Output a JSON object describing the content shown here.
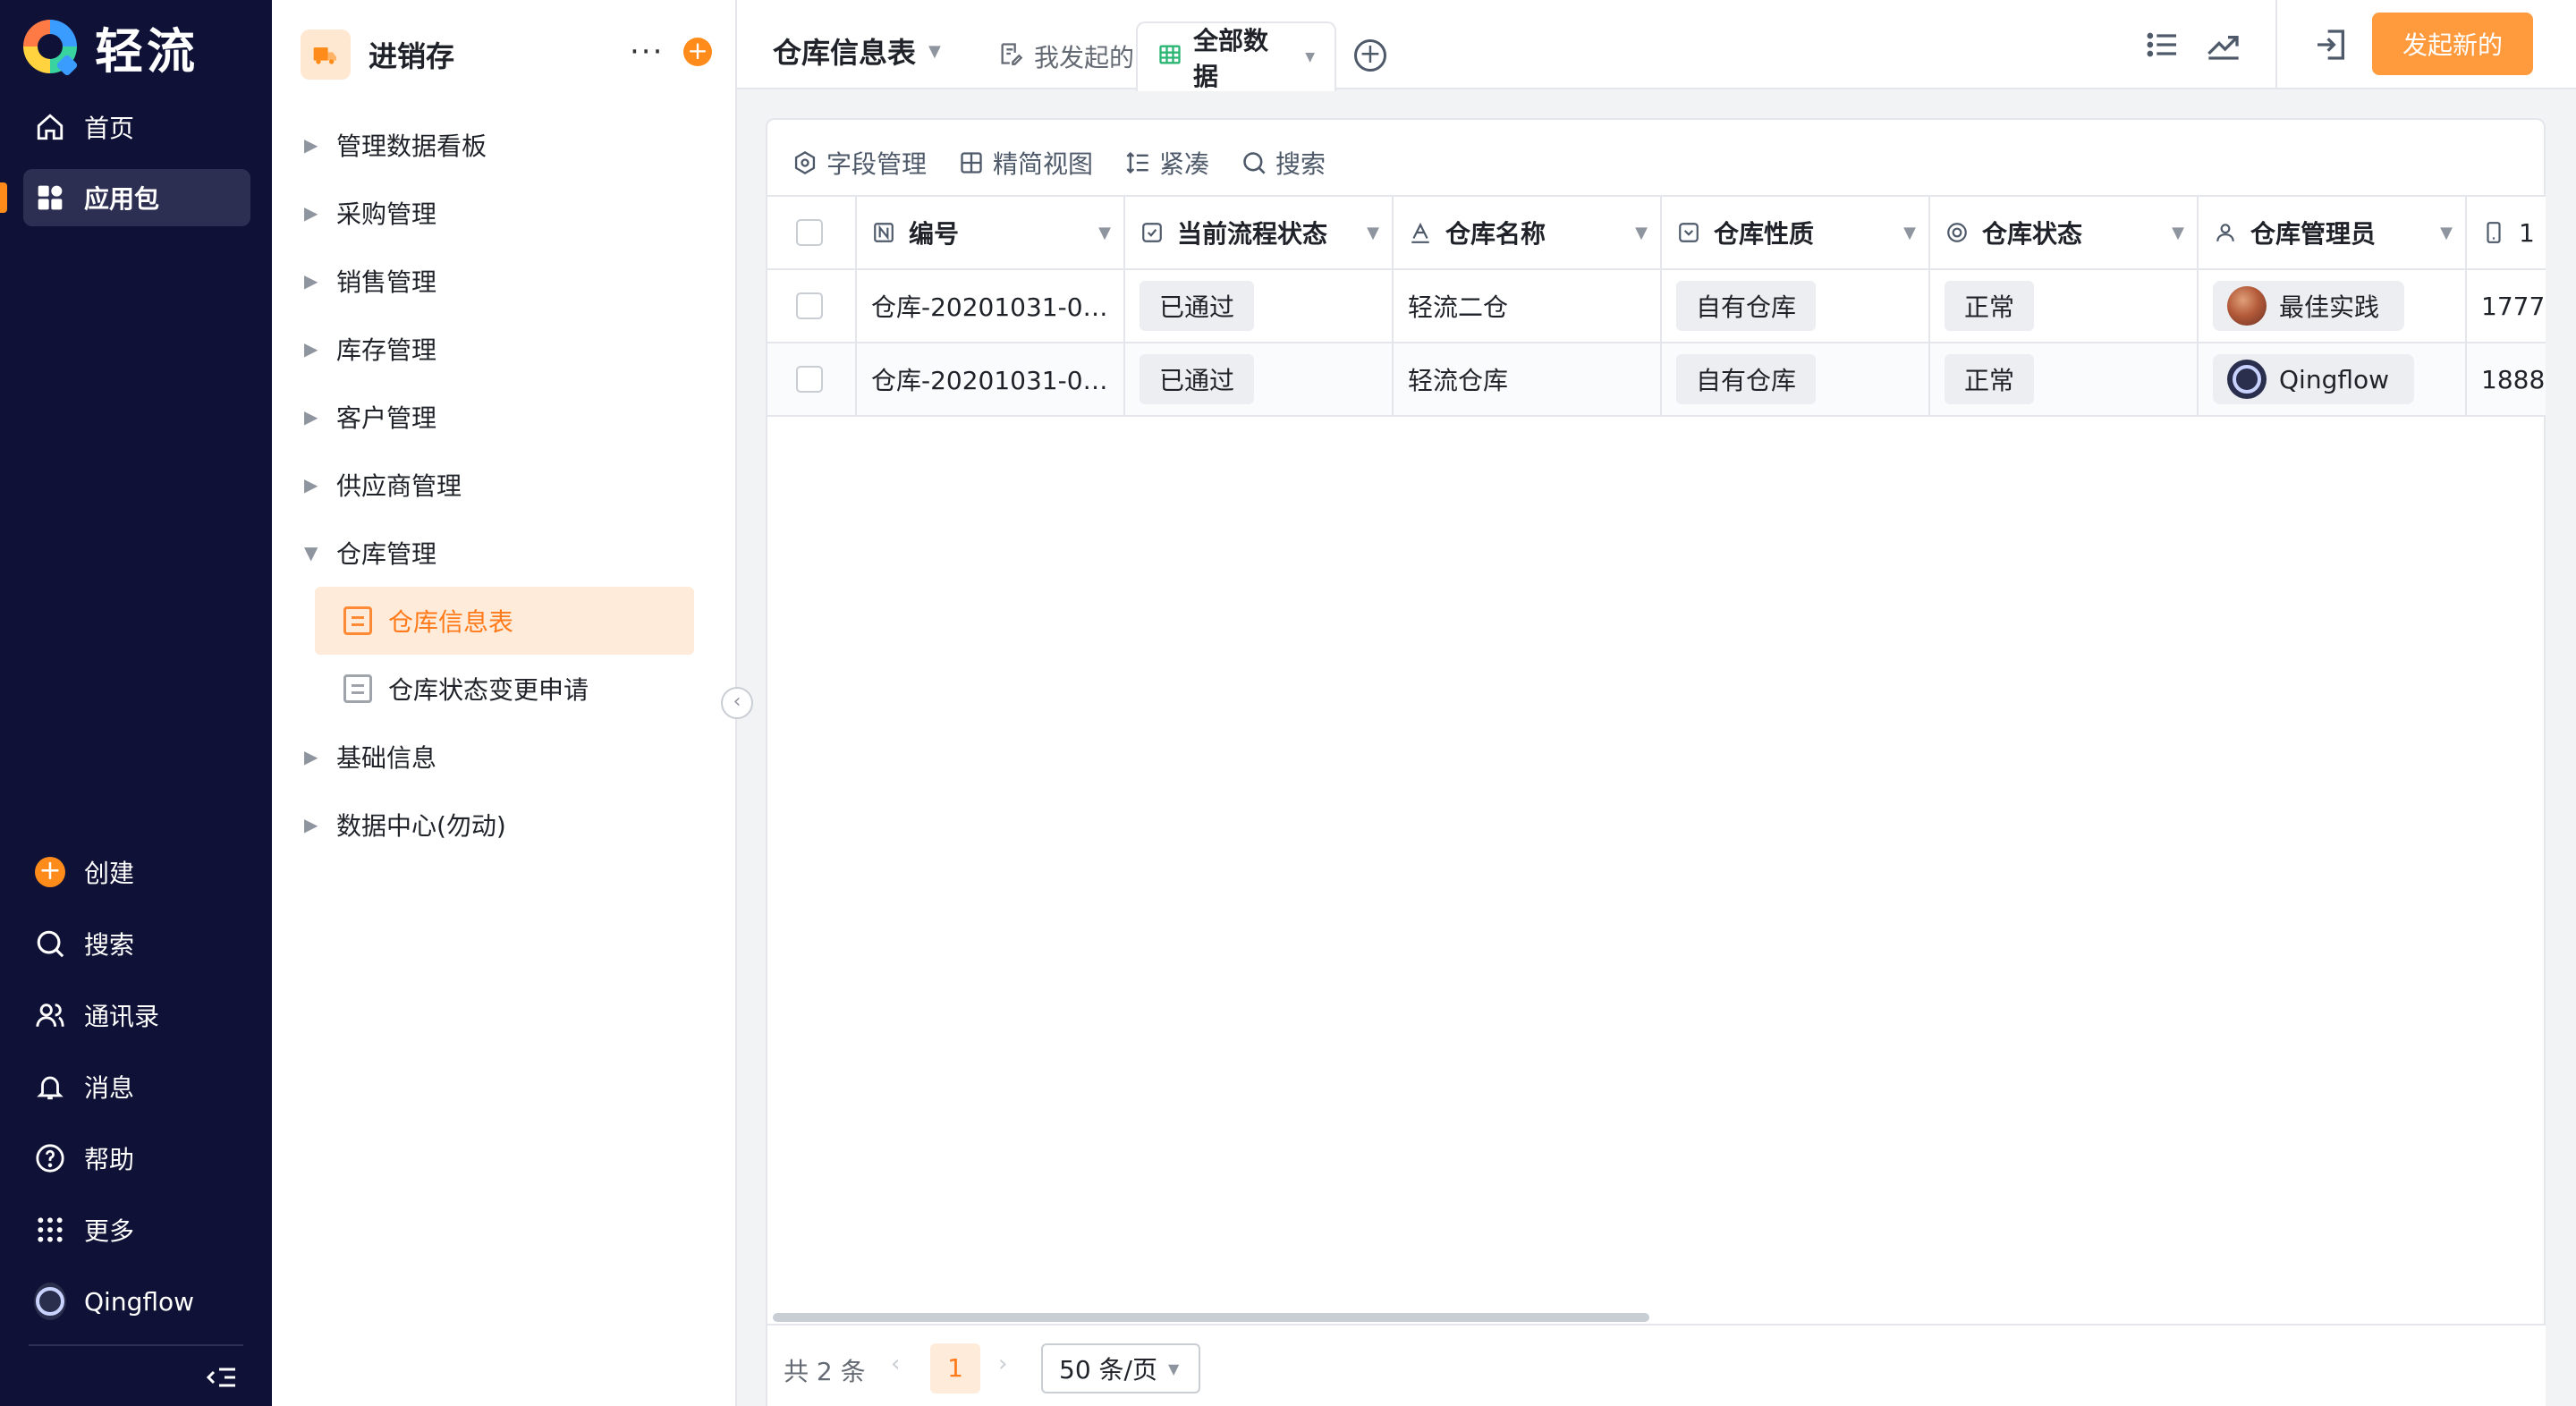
{
  "app": {
    "logo_text": "轻流"
  },
  "nav": {
    "items": [
      {
        "label": "首页",
        "icon": "home-icon"
      },
      {
        "label": "应用包",
        "icon": "apps-icon",
        "active": true
      }
    ],
    "bottom": [
      {
        "label": "创建",
        "icon": "plus-circle-icon"
      },
      {
        "label": "搜索",
        "icon": "search-icon"
      },
      {
        "label": "通讯录",
        "icon": "contacts-icon"
      },
      {
        "label": "消息",
        "icon": "bell-icon"
      },
      {
        "label": "帮助",
        "icon": "help-icon"
      },
      {
        "label": "更多",
        "icon": "grid-icon"
      },
      {
        "label": "Qingflow",
        "icon": "user-avatar-icon"
      }
    ],
    "accent": "#ff8c1a"
  },
  "sidebar": {
    "app_title": "进销存",
    "more": "···",
    "tree": [
      {
        "label": "管理数据看板"
      },
      {
        "label": "采购管理"
      },
      {
        "label": "销售管理"
      },
      {
        "label": "库存管理"
      },
      {
        "label": "客户管理"
      },
      {
        "label": "供应商管理"
      },
      {
        "label": "仓库管理",
        "expanded": true
      },
      {
        "label": "基础信息"
      },
      {
        "label": "数据中心(勿动)"
      }
    ],
    "sub_items": [
      {
        "label": "仓库信息表",
        "active": true
      },
      {
        "label": "仓库状态变更申请"
      }
    ]
  },
  "header": {
    "form_title": "仓库信息表",
    "tabs": [
      {
        "label": "我发起的"
      },
      {
        "label": "全部数据",
        "active": true
      }
    ],
    "new_button": "发起新的"
  },
  "toolbar": {
    "field_manage": "字段管理",
    "compact_view": "精简视图",
    "density": "紧凑",
    "search": "搜索"
  },
  "table": {
    "columns": [
      {
        "label": "编号",
        "icon": "number-field-icon"
      },
      {
        "label": "当前流程状态",
        "icon": "status-field-icon"
      },
      {
        "label": "仓库名称",
        "icon": "text-field-icon"
      },
      {
        "label": "仓库性质",
        "icon": "select-field-icon"
      },
      {
        "label": "仓库状态",
        "icon": "radio-field-icon"
      },
      {
        "label": "仓库管理员",
        "icon": "member-field-icon"
      },
      {
        "label": "1",
        "icon": "phone-field-icon"
      }
    ],
    "rows": [
      {
        "id": "仓库-20201031-0…",
        "status": "已通过",
        "name": "轻流二仓",
        "nature": "自有仓库",
        "state": "正常",
        "manager": "最佳实践",
        "phone": "1777"
      },
      {
        "id": "仓库-20201031-0…",
        "status": "已通过",
        "name": "轻流仓库",
        "nature": "自有仓库",
        "state": "正常",
        "manager": "Qingflow",
        "phone": "1888"
      }
    ]
  },
  "pagination": {
    "total": "共 2 条",
    "current_page": "1",
    "page_size": "50 条/页"
  }
}
